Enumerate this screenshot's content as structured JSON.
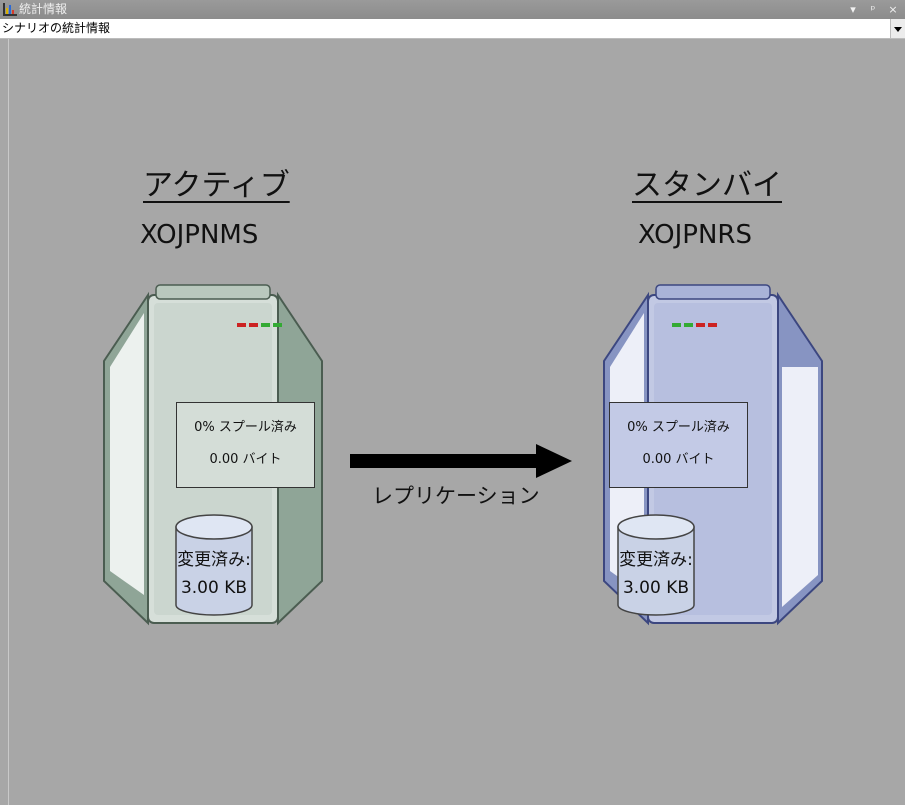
{
  "window": {
    "title": "統計情報",
    "controls": [
      "▾",
      "ᵖ",
      "×"
    ]
  },
  "scenario_select": {
    "value": "シナリオの統計情報"
  },
  "active": {
    "heading": "アクティブ",
    "host": "XOJPNMS",
    "spool_percent": "0% スプール済み",
    "spool_bytes": "0.00 バイト",
    "changed_label": "変更済み:",
    "changed_value": "3.00  KB",
    "lights": [
      "#cc2222",
      "#cc2222",
      "#33aa33",
      "#33aa33"
    ]
  },
  "standby": {
    "heading": "スタンバイ",
    "host": "XOJPNRS",
    "spool_percent": "0% スプール済み",
    "spool_bytes": "0.00 バイト",
    "changed_label": "変更済み:",
    "changed_value": "3.00  KB",
    "lights": [
      "#33aa33",
      "#33aa33",
      "#cc2222",
      "#cc2222"
    ]
  },
  "replication": {
    "label": "レプリケーション"
  },
  "colors": {
    "background": "#a7a7a7",
    "active_server": "#d7dfd9",
    "standby_server": "#c2c9e4"
  }
}
